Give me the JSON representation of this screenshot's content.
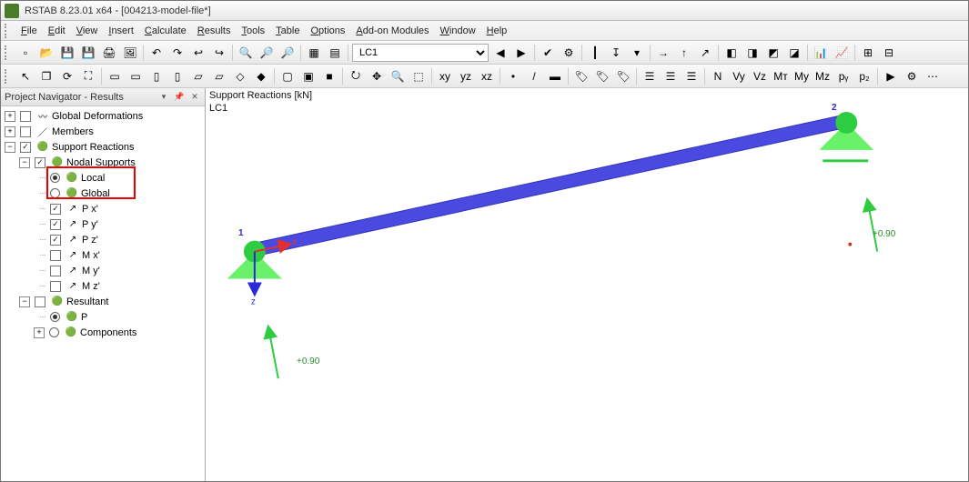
{
  "title": "RSTAB 8.23.01 x64 - [004213-model-file*]",
  "menu": [
    "File",
    "Edit",
    "View",
    "Insert",
    "Calculate",
    "Results",
    "Tools",
    "Table",
    "Options",
    "Add-on Modules",
    "Window",
    "Help"
  ],
  "lc_selected": "LC1",
  "toolbar1": [
    "new-doc",
    "open",
    "save",
    "save-all",
    "print",
    "print-preview",
    "|",
    "undo-arrow",
    "redo-arrow",
    "undo",
    "redo",
    "|",
    "zoom-extents",
    "find",
    "find-next",
    "|",
    "sheet",
    "tables-toggle",
    "|"
  ],
  "toolbar1_tail": [
    "nav-prev",
    "nav-next",
    "|",
    "check",
    "cfg",
    "|",
    "member-forces",
    "member-loads",
    "filter",
    "|",
    "rx",
    "ry",
    "rz",
    "|",
    "res-a",
    "res-b",
    "res-c",
    "res-d",
    "|",
    "chart",
    "graph",
    "|",
    "tool-a",
    "tool-b"
  ],
  "toolbar2": [
    "cursor",
    "window",
    "refresh",
    "fit",
    "|",
    "front",
    "back",
    "left",
    "right",
    "top",
    "bottom",
    "iso",
    "iso2",
    "|",
    "wire",
    "hidden",
    "shade",
    "|",
    "orbit",
    "pan",
    "zoom",
    "zoom-win",
    "|",
    "xy",
    "yz",
    "xz",
    "|",
    "node",
    "line",
    "surface",
    "|",
    "tag1",
    "tag2",
    "tag3",
    "|",
    "grp1",
    "grp2",
    "grp3",
    "|",
    "N",
    "Vy",
    "Vz",
    "Mt",
    "My",
    "Mz",
    "py",
    "pz",
    "|",
    "anim",
    "opts",
    "more"
  ],
  "navigator": {
    "title": "Project Navigator - Results",
    "items": {
      "global_def": "Global Deformations",
      "members": "Members",
      "support_reactions": "Support Reactions",
      "nodal_supports": "Nodal Supports",
      "local": "Local",
      "global": "Global",
      "px": "P x'",
      "py": "P y'",
      "pz": "P z'",
      "mx": "M x'",
      "my": "M y'",
      "mz": "M z'",
      "resultant": "Resultant",
      "p": "P",
      "components": "Components"
    }
  },
  "viewport": {
    "title": "Support Reactions [kN]",
    "lc": "LC1",
    "node1": "1",
    "node2": "2",
    "val1": "+0.90",
    "val2": "+0.90",
    "axis_x": "x",
    "axis_z": "z"
  }
}
